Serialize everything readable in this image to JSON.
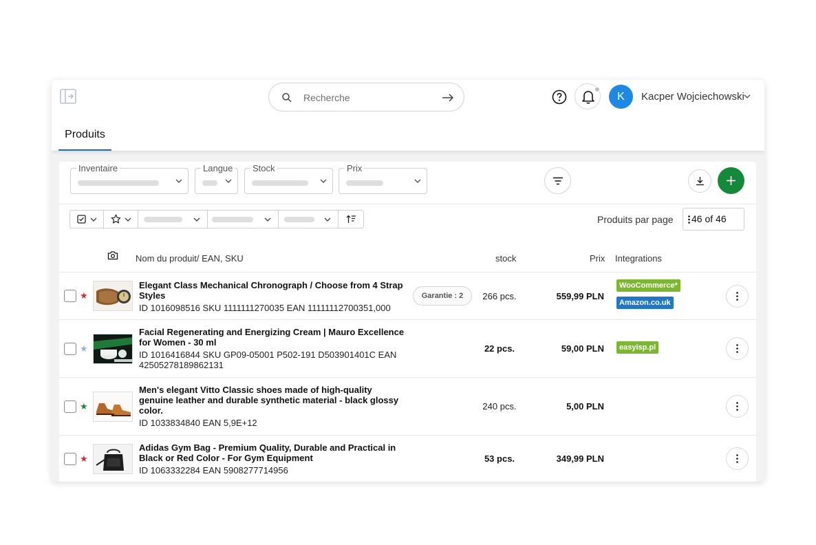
{
  "search": {
    "placeholder": "Recherche"
  },
  "user": {
    "name": "Kacper Wojciechowski",
    "initial": "K"
  },
  "tabs": [
    {
      "label": "Produits"
    }
  ],
  "filters": [
    {
      "label": "Inventaire"
    },
    {
      "label": "Langue"
    },
    {
      "label": "Stock"
    },
    {
      "label": "Prix"
    }
  ],
  "pagination": {
    "label": "Produits par page",
    "value": "46 of 46"
  },
  "table": {
    "headers": {
      "name": "Nom du produit/ EAN, SKU",
      "stock": "stock",
      "price": "Prix",
      "integrations": "Integrations"
    },
    "rows": [
      {
        "name": "Elegant Class Mechanical Chronograph / Choose from 4 Strap Styles",
        "ids": "ID 1016098516 SKU 1111111270035 EAN 11111112700351,000",
        "garantie": "Garantie : 2",
        "stock": "266 pcs.",
        "price": "559,99 PLN",
        "star_color": "#d32f2f",
        "integrations": [
          {
            "label": "WooCommerce*",
            "color": "#7cb82f"
          },
          {
            "label": "Amazon.co.uk",
            "color": "#1f77c9"
          }
        ]
      },
      {
        "name": "Facial Regenerating and Energizing Cream | Mauro Excellence for Women - 30 ml",
        "ids": "ID 1016416844 SKU GP09-05001 P502-191 D503901401C EAN 42505278189862131",
        "stock": "22 pcs.",
        "price": "59,00 PLN",
        "star_color": "#90b4e0",
        "integrations": [
          {
            "label": "easyisp.pl",
            "color": "#7cb82f"
          }
        ]
      },
      {
        "name": "Men's elegant Vitto Classic shoes made of high-quality genuine leather and durable synthetic material - black glossy color.",
        "ids": "ID 1033834840 EAN 5,9E+12",
        "stock": "240 pcs.",
        "price": "5,00 PLN",
        "star_color": "#1a8a3a",
        "integrations": []
      },
      {
        "name": "Adidas Gym Bag - Premium Quality, Durable and Practical in Black or Red Color - For Gym Equipment",
        "ids": "ID 1063332284 EAN 5908277714956",
        "stock": "53 pcs.",
        "price": "349,99 PLN",
        "star_color": "#d32f2f",
        "integrations": []
      }
    ]
  }
}
